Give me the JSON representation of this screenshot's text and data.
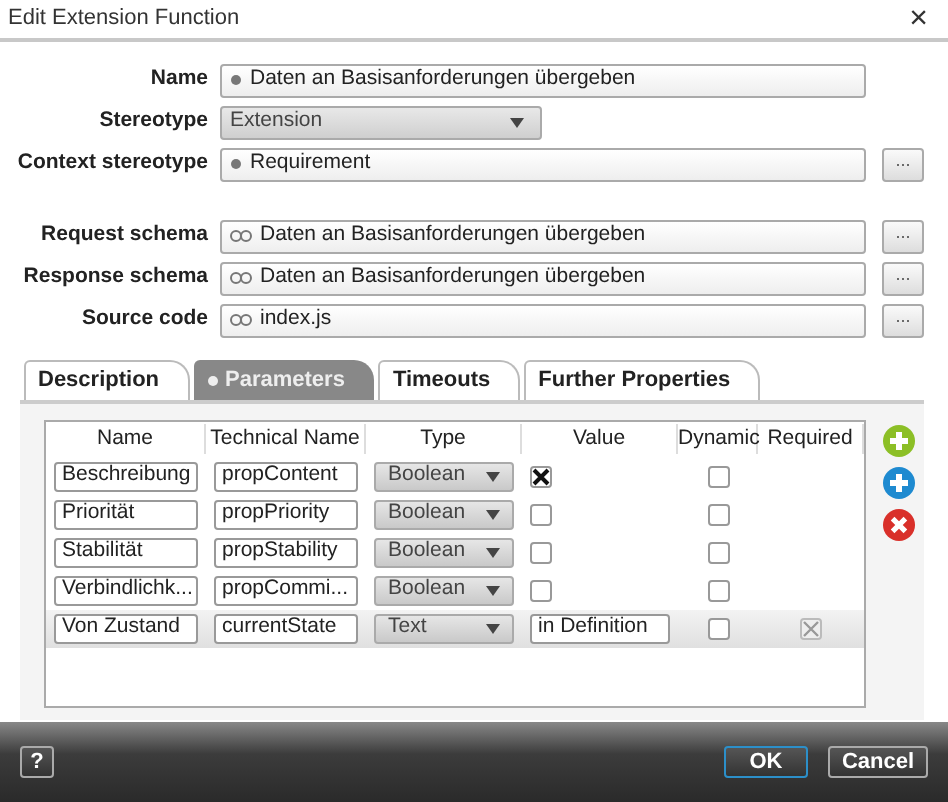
{
  "window": {
    "title": "Edit Extension Function",
    "close": "×"
  },
  "fields": [
    {
      "label": "Name",
      "kind": "element",
      "value": "Daten an Basisanforderungen übergeben"
    },
    {
      "label": "Stereotype",
      "kind": "select",
      "value": "Extension"
    },
    {
      "label": "Context stereotype",
      "kind": "element",
      "value": "Requirement",
      "browse": "..."
    },
    {
      "kind": "gap"
    },
    {
      "label": "Request schema",
      "kind": "reference",
      "value": "Daten an Basisanforderungen übergeben",
      "browse": "..."
    },
    {
      "label": "Response schema",
      "kind": "reference",
      "value": "Daten an Basisanforderungen übergeben",
      "browse": "..."
    },
    {
      "label": "Source code",
      "kind": "reference",
      "value": "index.js",
      "browse": "..."
    }
  ],
  "tabs": [
    {
      "label": "Description",
      "selected": false
    },
    {
      "label": "Parameters",
      "selected": true
    },
    {
      "label": "Timeouts",
      "selected": false
    },
    {
      "label": "Further Properties",
      "selected": false
    }
  ],
  "table": {
    "columns": [
      "Name",
      "Technical Name",
      "Type",
      "Value",
      "Dynamic",
      "Required"
    ],
    "rows": [
      {
        "kind": "boolean",
        "name": "Beschreibung",
        "technical_name": "propContent",
        "type": "Boolean",
        "value_checked": true,
        "dynamic": false,
        "selected": false
      },
      {
        "kind": "boolean",
        "name": "Priorität",
        "technical_name": "propPriority",
        "type": "Boolean",
        "value_checked": false,
        "dynamic": false,
        "selected": false
      },
      {
        "kind": "boolean",
        "name": "Stabilität",
        "technical_name": "propStability",
        "type": "Boolean",
        "value_checked": false,
        "dynamic": false,
        "selected": false
      },
      {
        "kind": "boolean",
        "name": "Verbindlichk...",
        "technical_name": "propCommi...",
        "type": "Boolean",
        "value_checked": false,
        "dynamic": false,
        "selected": false
      },
      {
        "kind": "text",
        "name": "Von Zustand",
        "technical_name": "currentState",
        "type": "Text",
        "value": "in Definition",
        "dynamic": false,
        "required": true,
        "selected": true
      }
    ]
  },
  "footer": {
    "help": "?",
    "ok": "OK",
    "cancel": "Cancel"
  }
}
